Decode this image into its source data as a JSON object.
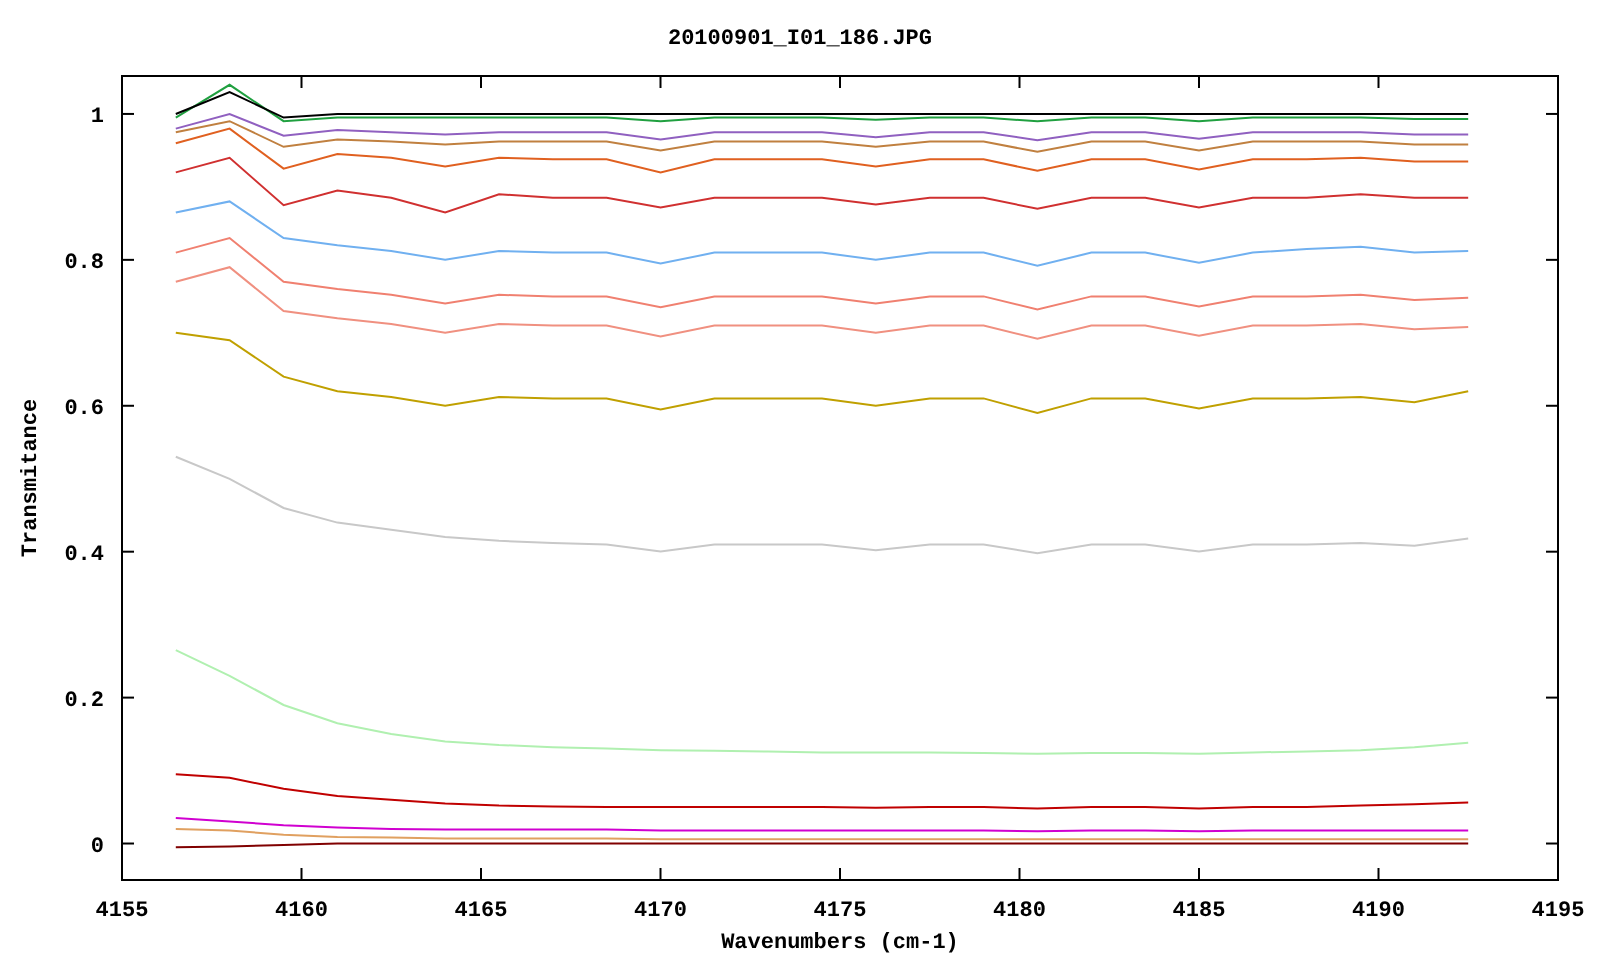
{
  "chart_data": {
    "type": "line",
    "title": "20100901_I01_186.JPG",
    "xlabel": "Wavenumbers (cm-1)",
    "ylabel": "Transmitance",
    "x": [
      4156.5,
      4158,
      4159.5,
      4161,
      4162.5,
      4164,
      4165.5,
      4167,
      4168.5,
      4170,
      4171.5,
      4173,
      4174.5,
      4176,
      4177.5,
      4179,
      4180.5,
      4182,
      4183.5,
      4185,
      4186.5,
      4188,
      4189.5,
      4191,
      4192.5
    ],
    "series": [
      {
        "color": "#000000",
        "values": [
          1.0,
          1.03,
          0.995,
          1.0,
          1.0,
          1.0,
          1.0,
          1.0,
          1.0,
          1.0,
          1.0,
          1.0,
          1.0,
          1.0,
          1.0,
          1.0,
          1.0,
          1.0,
          1.0,
          1.0,
          1.0,
          1.0,
          1.0,
          1.0,
          1.0
        ]
      },
      {
        "color": "#20a040",
        "values": [
          0.995,
          1.04,
          0.99,
          0.995,
          0.995,
          0.995,
          0.995,
          0.995,
          0.995,
          0.99,
          0.995,
          0.995,
          0.995,
          0.992,
          0.995,
          0.995,
          0.99,
          0.995,
          0.995,
          0.99,
          0.995,
          0.995,
          0.995,
          0.993,
          0.993
        ]
      },
      {
        "color": "#9060c0",
        "values": [
          0.98,
          1.0,
          0.97,
          0.978,
          0.975,
          0.972,
          0.975,
          0.975,
          0.975,
          0.965,
          0.975,
          0.975,
          0.975,
          0.968,
          0.975,
          0.975,
          0.964,
          0.975,
          0.975,
          0.966,
          0.975,
          0.975,
          0.975,
          0.972,
          0.972
        ]
      },
      {
        "color": "#c08040",
        "values": [
          0.975,
          0.99,
          0.955,
          0.965,
          0.962,
          0.958,
          0.962,
          0.962,
          0.962,
          0.95,
          0.962,
          0.962,
          0.962,
          0.955,
          0.962,
          0.962,
          0.948,
          0.962,
          0.962,
          0.95,
          0.962,
          0.962,
          0.962,
          0.958,
          0.958
        ]
      },
      {
        "color": "#e06020",
        "values": [
          0.96,
          0.98,
          0.925,
          0.945,
          0.94,
          0.928,
          0.94,
          0.938,
          0.938,
          0.92,
          0.938,
          0.938,
          0.938,
          0.928,
          0.938,
          0.938,
          0.922,
          0.938,
          0.938,
          0.924,
          0.938,
          0.938,
          0.94,
          0.935,
          0.935
        ]
      },
      {
        "color": "#d03030",
        "values": [
          0.92,
          0.94,
          0.875,
          0.895,
          0.885,
          0.865,
          0.89,
          0.885,
          0.885,
          0.872,
          0.885,
          0.885,
          0.885,
          0.876,
          0.885,
          0.885,
          0.87,
          0.885,
          0.885,
          0.872,
          0.885,
          0.885,
          0.89,
          0.885,
          0.885
        ]
      },
      {
        "color": "#70b0f0",
        "values": [
          0.865,
          0.88,
          0.83,
          0.82,
          0.812,
          0.8,
          0.812,
          0.81,
          0.81,
          0.795,
          0.81,
          0.81,
          0.81,
          0.8,
          0.81,
          0.81,
          0.792,
          0.81,
          0.81,
          0.796,
          0.81,
          0.815,
          0.818,
          0.81,
          0.812
        ]
      },
      {
        "color": "#f08070",
        "values": [
          0.81,
          0.83,
          0.77,
          0.76,
          0.752,
          0.74,
          0.752,
          0.75,
          0.75,
          0.735,
          0.75,
          0.75,
          0.75,
          0.74,
          0.75,
          0.75,
          0.732,
          0.75,
          0.75,
          0.736,
          0.75,
          0.75,
          0.752,
          0.745,
          0.748
        ]
      },
      {
        "color": "#f09080",
        "values": [
          0.77,
          0.79,
          0.73,
          0.72,
          0.712,
          0.7,
          0.712,
          0.71,
          0.71,
          0.695,
          0.71,
          0.71,
          0.71,
          0.7,
          0.71,
          0.71,
          0.692,
          0.71,
          0.71,
          0.696,
          0.71,
          0.71,
          0.712,
          0.705,
          0.708
        ]
      },
      {
        "color": "#c0a000",
        "values": [
          0.7,
          0.69,
          0.64,
          0.62,
          0.612,
          0.6,
          0.612,
          0.61,
          0.61,
          0.595,
          0.61,
          0.61,
          0.61,
          0.6,
          0.61,
          0.61,
          0.59,
          0.61,
          0.61,
          0.596,
          0.61,
          0.61,
          0.612,
          0.605,
          0.62
        ]
      },
      {
        "color": "#c8c8c8",
        "values": [
          0.53,
          0.5,
          0.46,
          0.44,
          0.43,
          0.42,
          0.415,
          0.412,
          0.41,
          0.4,
          0.41,
          0.41,
          0.41,
          0.402,
          0.41,
          0.41,
          0.398,
          0.41,
          0.41,
          0.4,
          0.41,
          0.41,
          0.412,
          0.408,
          0.418
        ]
      },
      {
        "color": "#b0f0b0",
        "values": [
          0.265,
          0.23,
          0.19,
          0.165,
          0.15,
          0.14,
          0.135,
          0.132,
          0.13,
          0.128,
          0.127,
          0.126,
          0.125,
          0.125,
          0.125,
          0.124,
          0.123,
          0.124,
          0.124,
          0.123,
          0.125,
          0.126,
          0.128,
          0.132,
          0.138
        ]
      },
      {
        "color": "#c00000",
        "values": [
          0.095,
          0.09,
          0.075,
          0.065,
          0.06,
          0.055,
          0.052,
          0.051,
          0.05,
          0.05,
          0.05,
          0.05,
          0.05,
          0.049,
          0.05,
          0.05,
          0.048,
          0.05,
          0.05,
          0.048,
          0.05,
          0.05,
          0.052,
          0.054,
          0.056
        ]
      },
      {
        "color": "#d000d0",
        "values": [
          0.035,
          0.03,
          0.025,
          0.022,
          0.02,
          0.019,
          0.019,
          0.019,
          0.019,
          0.018,
          0.018,
          0.018,
          0.018,
          0.018,
          0.018,
          0.018,
          0.017,
          0.018,
          0.018,
          0.017,
          0.018,
          0.018,
          0.018,
          0.018,
          0.018
        ]
      },
      {
        "color": "#e0a060",
        "values": [
          0.02,
          0.018,
          0.012,
          0.009,
          0.008,
          0.007,
          0.007,
          0.007,
          0.007,
          0.006,
          0.006,
          0.006,
          0.006,
          0.006,
          0.006,
          0.006,
          0.006,
          0.006,
          0.006,
          0.006,
          0.006,
          0.006,
          0.006,
          0.006,
          0.006
        ]
      },
      {
        "color": "#800000",
        "values": [
          -0.005,
          -0.004,
          -0.002,
          0.0,
          0.0,
          0.0,
          0.0,
          0.0,
          0.0,
          0.0,
          0.0,
          0.0,
          0.0,
          0.0,
          0.0,
          0.0,
          0.0,
          0.0,
          0.0,
          0.0,
          0.0,
          0.0,
          0.0,
          0.0,
          0.0
        ]
      }
    ],
    "xlim": [
      4155,
      4195
    ],
    "ylim": [
      -0.05,
      1.052
    ],
    "xticks": [
      4155,
      4160,
      4165,
      4170,
      4175,
      4180,
      4185,
      4190,
      4195
    ],
    "yticks": [
      {
        "value": 0,
        "label": "0"
      },
      {
        "value": 0.2,
        "label": "0.2"
      },
      {
        "value": 0.4,
        "label": "0.4"
      },
      {
        "value": 0.6,
        "label": "0.6"
      },
      {
        "value": 0.8,
        "label": "0.8"
      },
      {
        "value": 1,
        "label": "1"
      }
    ]
  }
}
